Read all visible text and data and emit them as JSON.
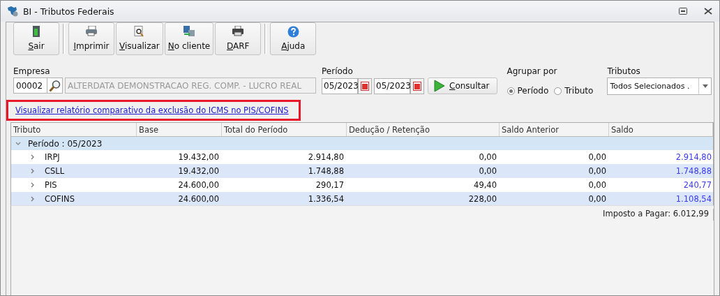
{
  "window": {
    "title": "BI - Tributos Federais"
  },
  "toolbar": [
    {
      "label": "Sair"
    },
    {
      "label": "Imprimir"
    },
    {
      "label": "Visualizar"
    },
    {
      "label": "No cliente"
    },
    {
      "label": "DARF"
    },
    {
      "label": "Ajuda"
    }
  ],
  "empresa": {
    "label": "Empresa",
    "code": "00002",
    "name": "ALTERDATA DEMONSTRACAO REG. COMP. - LUCRO REAL"
  },
  "periodo": {
    "label": "Período",
    "start": "05/2023",
    "end": "05/2023"
  },
  "consultar": {
    "label": "Consultar"
  },
  "agrupar": {
    "label": "Agrupar por",
    "options": [
      {
        "label": "Período",
        "selected": true
      },
      {
        "label": "Tributo",
        "selected": false
      }
    ]
  },
  "tributos": {
    "label": "Tributos",
    "value": "Todos Selecionados ."
  },
  "link": {
    "text": "Visualizar relatório comparativo da exclusão do ICMS no PIS/COFINS",
    "highlighted": true
  },
  "table": {
    "columns": [
      "Tributo",
      "Base",
      "Total do Período",
      "Dedução / Retenção",
      "Saldo Anterior",
      "Saldo"
    ],
    "groups": [
      {
        "label": "Período : 05/2023",
        "expanded": true,
        "children": [
          {
            "cells": [
              "IRPJ",
              "19.432,00",
              "2.914,80",
              "0,00",
              "0,00",
              "2.914,80"
            ],
            "expanded": false
          },
          {
            "cells": [
              "CSLL",
              "19.432,00",
              "1.748,88",
              "0,00",
              "0,00",
              "1.748,88"
            ],
            "expanded": false
          },
          {
            "cells": [
              "PIS",
              "24.600,00",
              "290,17",
              "49,40",
              "0,00",
              "240,77"
            ],
            "expanded": false
          },
          {
            "cells": [
              "COFINS",
              "24.600,00",
              "1.336,54",
              "228,00",
              "0,00",
              "1.108,54"
            ],
            "expanded": false
          }
        ]
      }
    ]
  },
  "footer": "Imposto a Pagar: 6.012,99"
}
